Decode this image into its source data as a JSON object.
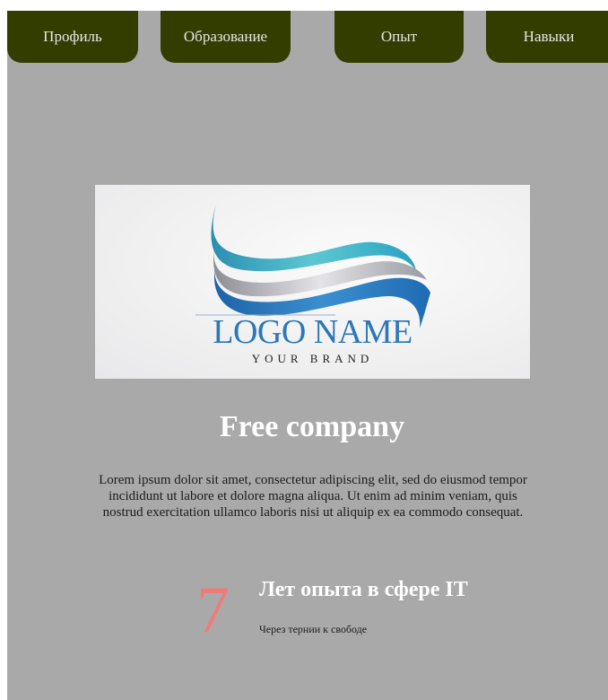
{
  "nav": {
    "tabs": [
      {
        "label": "Профиль"
      },
      {
        "label": "Образование"
      },
      {
        "label": "Опыт"
      },
      {
        "label": "Навыки"
      }
    ]
  },
  "logo": {
    "name": "LOGO NAME",
    "brand": "YOUR BRAND"
  },
  "company": {
    "title": "Free company",
    "description": "Lorem ipsum dolor sit amet, consectetur adipiscing elit, sed do eiusmod tempor incididunt ut labore et dolore magna aliqua. Ut enim ad minim veniam, quis nostrud exercitation ullamco laboris nisi ut aliquip ex ea commodo consequat."
  },
  "experience": {
    "years": "7",
    "title": "Лет опыта в сфере IT",
    "subtitle": "Через тернии к свободе"
  },
  "colors": {
    "page_background": "#a9a9a9",
    "nav_tab": "#333d00",
    "nav_text": "#e6e6e6",
    "accent_number": "#f07a7a",
    "logo_text": "#2a77b9"
  }
}
